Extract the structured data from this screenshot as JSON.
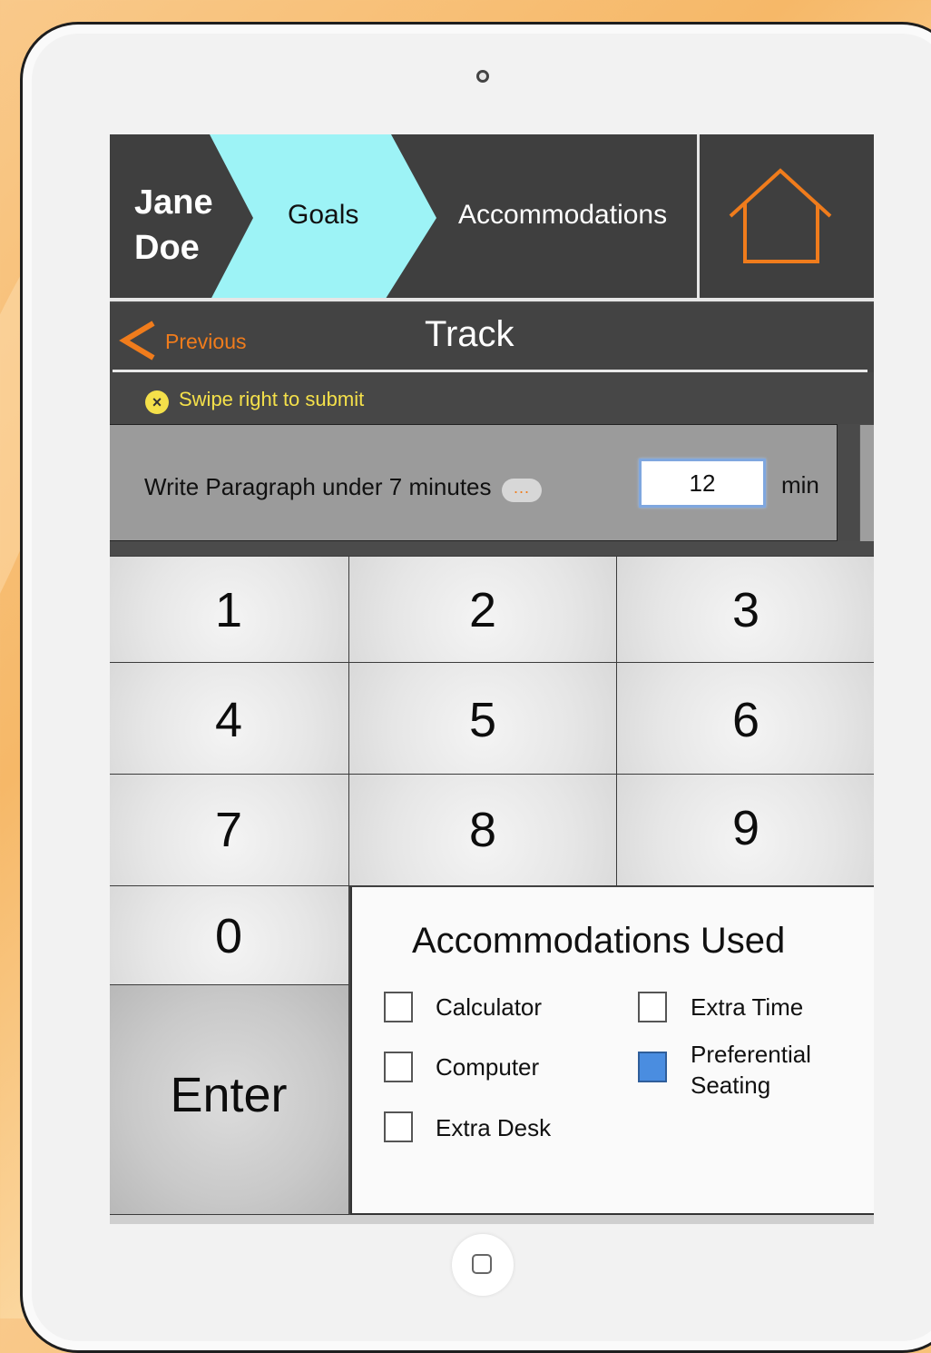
{
  "header": {
    "student_first": "Jane",
    "student_last": "Doe",
    "goals_label": "Goals",
    "accommodations_label": "Accommodations",
    "home_icon": "home-icon"
  },
  "nav": {
    "previous_label": "Previous",
    "title": "Track"
  },
  "notice": {
    "icon": "close-circle-icon",
    "text": "Swipe right to submit"
  },
  "goal": {
    "label": "Write Paragraph under 7 minutes",
    "more_label": "...",
    "value": "12",
    "unit": "min"
  },
  "keypad": {
    "keys": [
      "1",
      "2",
      "3",
      "4",
      "5",
      "6",
      "7",
      "8",
      "9",
      "0"
    ],
    "enter_label": "Enter"
  },
  "accommodations_used": {
    "title": "Accommodations Used",
    "items": [
      {
        "label": "Calculator",
        "checked": false
      },
      {
        "label": "Extra Time",
        "checked": false
      },
      {
        "label": "Computer",
        "checked": false
      },
      {
        "label": "Preferential Seating",
        "checked": true
      },
      {
        "label": "Extra Desk",
        "checked": false
      }
    ]
  },
  "colors": {
    "accent_orange": "#f07c1c",
    "goals_tab": "#9df3f6",
    "notice_yellow": "#f4e04a",
    "checked_blue": "#4a8de0"
  }
}
